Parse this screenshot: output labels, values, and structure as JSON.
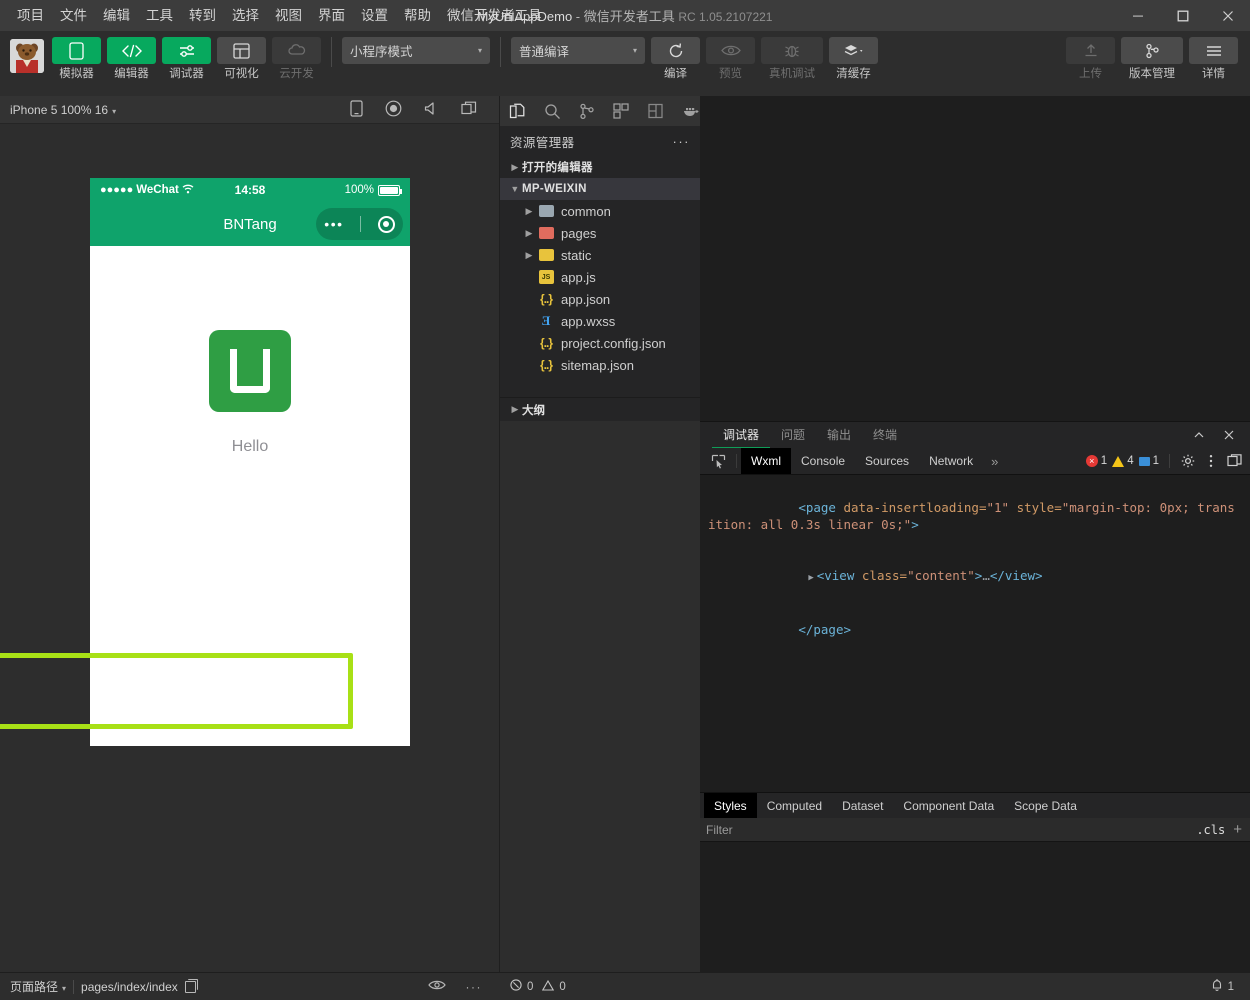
{
  "window": {
    "title_app": "MyUniAppDemo",
    "title_sep": " - ",
    "title_tool": "微信开发者工具",
    "title_version": "RC 1.05.2107221",
    "controls": {
      "minimize": "minimize-icon",
      "maximize": "maximize-icon",
      "close": "close-icon"
    }
  },
  "menubar": {
    "items": [
      {
        "label": "项目"
      },
      {
        "label": "文件"
      },
      {
        "label": "编辑"
      },
      {
        "label": "工具"
      },
      {
        "label": "转到"
      },
      {
        "label": "选择"
      },
      {
        "label": "视图"
      },
      {
        "label": "界面"
      },
      {
        "label": "设置"
      },
      {
        "label": "帮助"
      },
      {
        "label": "微信开发者工具"
      }
    ]
  },
  "toolbar": {
    "buttons": [
      {
        "label": "模拟器",
        "icon": "phone-icon",
        "state": "active"
      },
      {
        "label": "编辑器",
        "icon": "code-icon",
        "state": "active"
      },
      {
        "label": "调试器",
        "icon": "sliders-icon",
        "state": "active"
      },
      {
        "label": "可视化",
        "icon": "layout-icon",
        "state": "normal"
      },
      {
        "label": "云开发",
        "icon": "cloud-icon",
        "state": "disabled"
      }
    ],
    "mode_select": {
      "value": "小程序模式",
      "caret": "▾"
    },
    "compile_select": {
      "value": "普通编译",
      "caret": "▾"
    },
    "actions": [
      {
        "label": "编译",
        "icon": "refresh-icon",
        "state": "normal"
      },
      {
        "label": "预览",
        "icon": "eye-icon",
        "state": "disabled"
      },
      {
        "label": "真机调试",
        "icon": "bug-icon",
        "state": "disabled"
      },
      {
        "label": "清缓存",
        "icon": "layers-icon",
        "state": "normal"
      }
    ],
    "right_actions": [
      {
        "label": "上传",
        "icon": "upload-icon",
        "state": "disabled"
      },
      {
        "label": "版本管理",
        "icon": "branch-icon",
        "state": "normal"
      },
      {
        "label": "详情",
        "icon": "menu-icon",
        "state": "normal"
      }
    ]
  },
  "simulator": {
    "device_label": "iPhone 5 100% 16",
    "caret": "▾",
    "bar_icons": [
      "phone-rotate-icon",
      "record-icon",
      "volume-icon",
      "window-icon"
    ],
    "phone": {
      "status": {
        "carrier": "WeChat",
        "signal_dots": "●●●●●",
        "wifi": "wifi-icon",
        "time": "14:58",
        "battery_pct": "100%"
      },
      "nav_title": "BNTang",
      "capsule": {
        "dots": "•••",
        "target": "target-icon"
      },
      "content": {
        "logo": "uni-app-logo",
        "text": "Hello"
      }
    },
    "highlight_color": "#a8e016"
  },
  "explorer": {
    "activity_icons": [
      "files-icon",
      "search-icon",
      "source-control-icon",
      "extensions-icon",
      "split-editor-icon",
      "docker-icon"
    ],
    "header": {
      "title": "资源管理器",
      "more": "···"
    },
    "sections": [
      {
        "label": "打开的编辑器",
        "expanded": false,
        "arrow": "▶"
      },
      {
        "label": "MP-WEIXIN",
        "expanded": true,
        "arrow": "▼",
        "selected": true
      }
    ],
    "files": [
      {
        "name": "common",
        "type": "folder",
        "arrow": "▶",
        "color": "#9aa7b0"
      },
      {
        "name": "pages",
        "type": "folder",
        "arrow": "▶",
        "color": "#e06c5e"
      },
      {
        "name": "static",
        "type": "folder",
        "arrow": "▶",
        "color": "#e8c33c"
      },
      {
        "name": "app.js",
        "type": "js",
        "arrow": ""
      },
      {
        "name": "app.json",
        "type": "json",
        "arrow": ""
      },
      {
        "name": "app.wxss",
        "type": "wxss",
        "arrow": ""
      },
      {
        "name": "project.config.json",
        "type": "json",
        "arrow": ""
      },
      {
        "name": "sitemap.json",
        "type": "json",
        "arrow": ""
      }
    ],
    "outline": {
      "label": "大纲",
      "arrow": "▶"
    }
  },
  "debugger": {
    "panel_tabs": [
      {
        "label": "调试器",
        "active": true
      },
      {
        "label": "问题",
        "active": false
      },
      {
        "label": "输出",
        "active": false
      },
      {
        "label": "终端",
        "active": false
      }
    ],
    "panel_controls": [
      "chevron-up-icon",
      "close-icon"
    ],
    "devtools_tabs": [
      {
        "label": "Wxml",
        "active": true
      },
      {
        "label": "Console",
        "active": false
      },
      {
        "label": "Sources",
        "active": false
      },
      {
        "label": "Network",
        "active": false
      }
    ],
    "more_tabs": "»",
    "inspect_icon": "inspect-element-icon",
    "counters": {
      "errors": "1",
      "warnings": "4",
      "infos": "1"
    },
    "right_icons": [
      "gear-icon",
      "kebab-icon",
      "dock-icon"
    ],
    "wxml": {
      "line1": {
        "open": "<page",
        "attr1_name": " data-insertloading=",
        "attr1_value": "\"1\"",
        "attr2_name": " style=",
        "attr2_value": "\"margin-top: 0px; transition: all 0.3s linear 0s;\"",
        "close": ">"
      },
      "line2": {
        "arrow": "▶",
        "open": "<view",
        "attr_name": " class=",
        "attr_value": "\"content\"",
        "gt": ">",
        "ellipsis": "…",
        "close": "</view>"
      },
      "line3": {
        "close": "</page>"
      }
    },
    "styles_tabs": [
      {
        "label": "Styles",
        "active": true
      },
      {
        "label": "Computed",
        "active": false
      },
      {
        "label": "Dataset",
        "active": false
      },
      {
        "label": "Component Data",
        "active": false
      },
      {
        "label": "Scope Data",
        "active": false
      }
    ],
    "filter": {
      "placeholder": "Filter",
      "value": "",
      "cls": ".cls",
      "plus": "+"
    }
  },
  "statusbar": {
    "left": {
      "page_path_label": "页面路径",
      "caret": "▾",
      "path": "pages/index/index",
      "copy_icon": "copy-icon",
      "eye_icon": "eye-icon",
      "more": "···"
    },
    "right": {
      "error_icon": "error-circle-icon",
      "error_count": "0",
      "warn_icon": "warning-triangle-icon",
      "warn_count": "0",
      "bell_icon": "bell-icon",
      "bell_count": "1"
    }
  }
}
